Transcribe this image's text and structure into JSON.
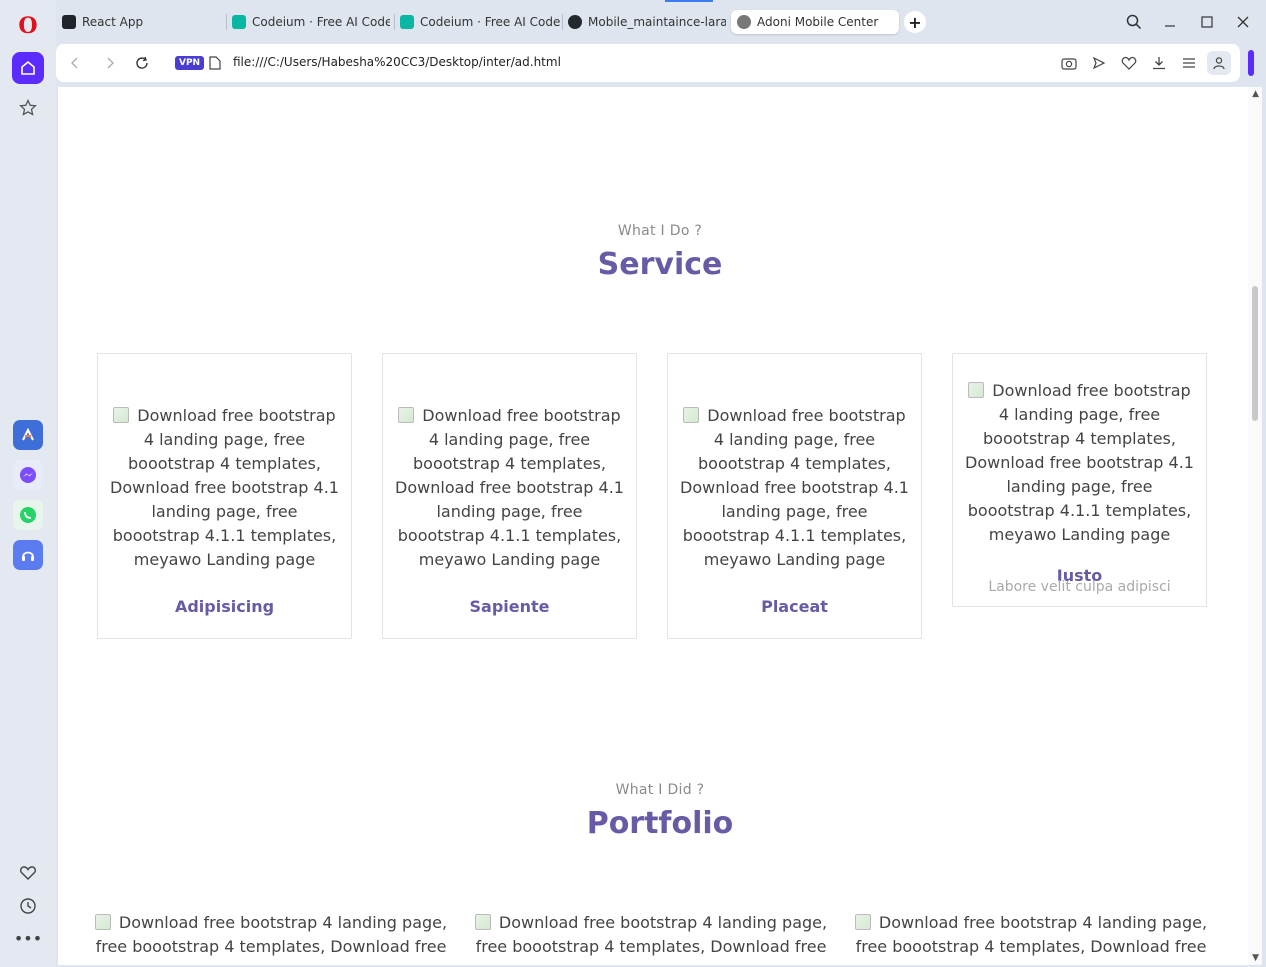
{
  "browser": {
    "tabs": [
      {
        "label": "React App",
        "icon": "react-icon"
      },
      {
        "label": "Codeium · Free AI Code Co",
        "icon": "codeium-icon"
      },
      {
        "label": "Codeium · Free AI Code Co",
        "icon": "codeium-icon"
      },
      {
        "label": "Mobile_maintaince-laravel",
        "icon": "github-icon"
      },
      {
        "label": "Adoni Mobile Center",
        "icon": "globe-icon"
      }
    ],
    "vpn_label": "VPN",
    "url": "file:///C:/Users/Habesha%20CC3/Desktop/inter/ad.html"
  },
  "service": {
    "subtitle": "What I Do ?",
    "title": "Service",
    "cards": [
      {
        "alt": "Download free bootstrap 4 landing page, free boootstrap 4 templates, Download free bootstrap 4.1 landing page, free boootstrap 4.1.1 templates, meyawo Landing page",
        "title": "Adipisicing"
      },
      {
        "alt": "Download free bootstrap 4 landing page, free boootstrap 4 templates, Download free bootstrap 4.1 landing page, free boootstrap 4.1.1 templates, meyawo Landing page",
        "title": "Sapiente"
      },
      {
        "alt": "Download free bootstrap 4 landing page, free boootstrap 4 templates, Download free bootstrap 4.1 landing page, free boootstrap 4.1.1 templates, meyawo Landing page",
        "title": "Placeat"
      },
      {
        "alt": "Download free bootstrap 4 landing page, free boootstrap 4 templates, Download free bootstrap 4.1 landing page, free boootstrap 4.1.1 templates, meyawo Landing page",
        "title": "Iusto",
        "text": "Labore velit culpa adipisci"
      }
    ]
  },
  "portfolio": {
    "subtitle": "What I Did ?",
    "title": "Portfolio",
    "items": [
      {
        "alt": "Download free bootstrap 4 landing page, free boootstrap 4 templates, Download free"
      },
      {
        "alt": "Download free bootstrap 4 landing page, free boootstrap 4 templates, Download free"
      },
      {
        "alt": "Download free bootstrap 4 landing page, free boootstrap 4 templates, Download free"
      }
    ]
  },
  "colors": {
    "accent": "#695aa6",
    "opera_purple": "#5b2bff",
    "opera_red": "#e0101f"
  }
}
